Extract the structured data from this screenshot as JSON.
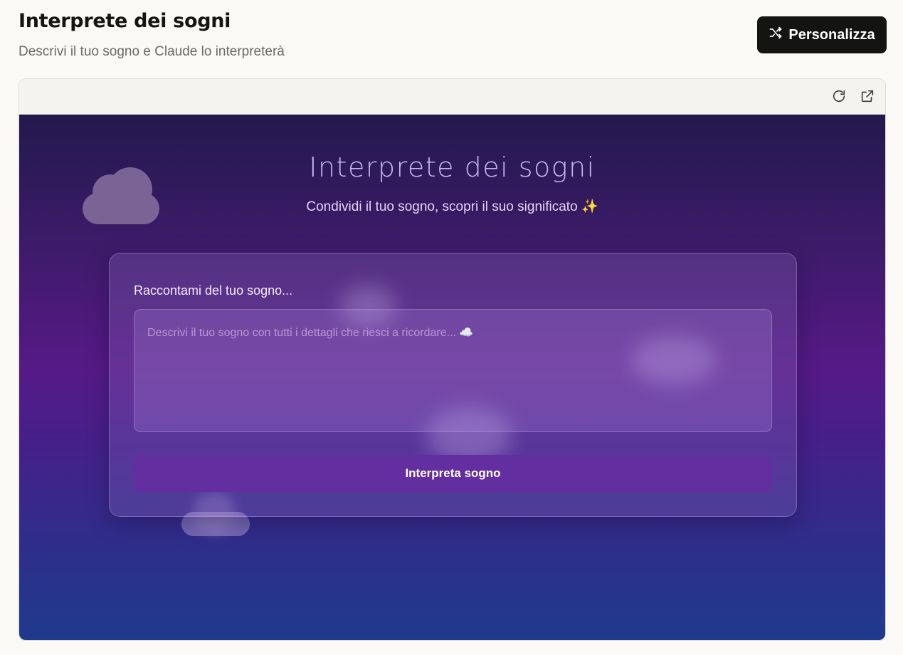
{
  "header": {
    "title": "Interprete dei sogni",
    "subtitle": "Descrivi il tuo sogno e Claude lo interpreterà",
    "personalize_label": "Personalizza"
  },
  "frame": {
    "icons": [
      "refresh-icon",
      "external-link-icon"
    ]
  },
  "app": {
    "title": "Interprete dei sogni",
    "subtitle": "Condividi il tuo sogno, scopri il suo significato",
    "subtitle_emoji": "✨",
    "card": {
      "label": "Raccontami del tuo sogno...",
      "textarea_placeholder": "Descrivi il tuo sogno con tutti i dettagli che riesci a ricordare... ☁️",
      "textarea_value": "",
      "button_label": "Interpreta sogno"
    }
  },
  "colors": {
    "accent_button": "#632fa0",
    "header_button": "#141413",
    "background_top": "#22194d",
    "background_bottom": "#1f3a8e"
  }
}
